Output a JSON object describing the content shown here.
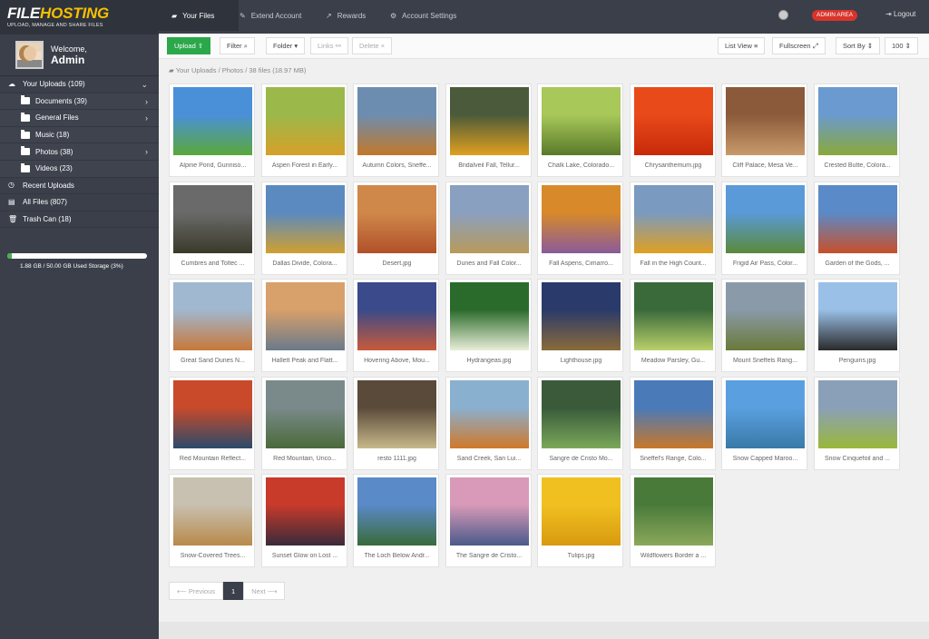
{
  "brand": {
    "logo_a": "FILE",
    "logo_b": "HOSTING",
    "tagline": "UPLOAD, MANAGE AND SHARE FILES"
  },
  "user": {
    "welcome": "Welcome,",
    "name": "Admin"
  },
  "sidebar": {
    "items": [
      {
        "label": "Your Uploads (109)",
        "icon": "cloud-icon",
        "level": 0,
        "chevron": "down"
      },
      {
        "label": "Documents (39)",
        "icon": "folder-icon",
        "level": 1,
        "chevron": "right"
      },
      {
        "label": "General Files",
        "icon": "folder-icon",
        "level": 1,
        "chevron": "right"
      },
      {
        "label": "Music (18)",
        "icon": "folder-icon",
        "level": 1,
        "chevron": ""
      },
      {
        "label": "Photos (38)",
        "icon": "folder-icon",
        "level": 1,
        "chevron": "right"
      },
      {
        "label": "Videos (23)",
        "icon": "folder-icon",
        "level": 1,
        "chevron": ""
      },
      {
        "label": "Recent Uploads",
        "icon": "clock-icon",
        "level": 0,
        "chevron": ""
      },
      {
        "label": "All Files (807)",
        "icon": "file-icon",
        "level": 0,
        "chevron": ""
      },
      {
        "label": "Trash Can (18)",
        "icon": "trash-icon",
        "level": 0,
        "chevron": ""
      }
    ],
    "storage_text": "1.88 GB / 50.00 GB Used Storage (3%)",
    "storage_fraction": 0.03
  },
  "topnav": {
    "tabs": [
      "Your Files",
      "Extend Account",
      "Rewards",
      "Account Settings"
    ],
    "admin": "ADMIN AREA",
    "logout": "Logout"
  },
  "toolbar": {
    "upload": "Upload",
    "filter": "Filter",
    "folder": "Folder",
    "links": "Links",
    "delete": "Delete",
    "list_view": "List View",
    "fullscreen": "Fullscreen",
    "sort": "Sort By",
    "per_page": "100"
  },
  "breadcrumb": {
    "root": "Your Uploads",
    "folder": "Photos",
    "count": "38 files (18.97 MB)"
  },
  "files": [
    {
      "name": "Alpine Pond, Gunniso...",
      "c1": "#4a90d9",
      "c2": "#5aa83a"
    },
    {
      "name": "Aspen Forest in Early...",
      "c1": "#9bb84a",
      "c2": "#d6a02a"
    },
    {
      "name": "Autumn Colors, Sneffe...",
      "c1": "#6d8db0",
      "c2": "#c2782a"
    },
    {
      "name": "Bridalveil Fall, Tellur...",
      "c1": "#4a5a3a",
      "c2": "#e0a020"
    },
    {
      "name": "Chalk Lake, Colorado...",
      "c1": "#a8c85a",
      "c2": "#5a7a2a"
    },
    {
      "name": "Chrysanthemum.jpg",
      "c1": "#e84a1a",
      "c2": "#c82a0a"
    },
    {
      "name": "Cliff Palace, Mesa Ve...",
      "c1": "#8a5a3a",
      "c2": "#c89a6a"
    },
    {
      "name": "Crested Butte, Colora...",
      "c1": "#6a9ad0",
      "c2": "#8aa83a"
    },
    {
      "name": "Cumbres and Toltec ...",
      "c1": "#6a6a6a",
      "c2": "#3a3a2a"
    },
    {
      "name": "Dallas Divide, Colora...",
      "c1": "#5a8ac0",
      "c2": "#d0a030"
    },
    {
      "name": "Desert.jpg",
      "c1": "#d0884a",
      "c2": "#b0502a"
    },
    {
      "name": "Dunes and Fall Color...",
      "c1": "#8aa0c0",
      "c2": "#b89a5a"
    },
    {
      "name": "Fall Aspens, Cimarro...",
      "c1": "#d88a2a",
      "c2": "#8a5a9a"
    },
    {
      "name": "Fall in the High Count...",
      "c1": "#7a9ac0",
      "c2": "#e0a020"
    },
    {
      "name": "Frigid Air Pass, Color...",
      "c1": "#5a9ad8",
      "c2": "#5a8a3a"
    },
    {
      "name": "Garden of the Gods, ...",
      "c1": "#5a8ac8",
      "c2": "#c8502a"
    },
    {
      "name": "Great Sand Dunes N...",
      "c1": "#a0b8d0",
      "c2": "#c8783a"
    },
    {
      "name": "Hallett Peak and Flatt...",
      "c1": "#d8a06a",
      "c2": "#6a7a8a"
    },
    {
      "name": "Hovering Above, Mou...",
      "c1": "#3a4a8a",
      "c2": "#c85a3a"
    },
    {
      "name": "Hydrangeas.jpg",
      "c1": "#2a6a2a",
      "c2": "#e8eed8"
    },
    {
      "name": "Lighthouse.jpg",
      "c1": "#2a3a6a",
      "c2": "#8a6a3a"
    },
    {
      "name": "Meadow Parsley, Gu...",
      "c1": "#3a6a3a",
      "c2": "#b8d06a"
    },
    {
      "name": "Mount Sneffels Rang...",
      "c1": "#8a9aa8",
      "c2": "#6a7a3a"
    },
    {
      "name": "Penguins.jpg",
      "c1": "#9ac0e8",
      "c2": "#2a2a2a"
    },
    {
      "name": "Red Mountain Reflect...",
      "c1": "#c84a2a",
      "c2": "#2a4a6a"
    },
    {
      "name": "Red Mountain, Unco...",
      "c1": "#7a8a8a",
      "c2": "#4a6a3a"
    },
    {
      "name": "resto 1111.jpg",
      "c1": "#5a4a3a",
      "c2": "#c8b88a"
    },
    {
      "name": "Sand Creek, San Lui...",
      "c1": "#8ab0d0",
      "c2": "#d0782a"
    },
    {
      "name": "Sangre de Cristo Mo...",
      "c1": "#3a5a3a",
      "c2": "#7aa85a"
    },
    {
      "name": "Sneffel's Range, Colo...",
      "c1": "#4a7ab8",
      "c2": "#c8782a"
    },
    {
      "name": "Snow Capped Maroo...",
      "c1": "#5aa0e0",
      "c2": "#3a7aa8"
    },
    {
      "name": "Snow Cinquefoil and ...",
      "c1": "#8aa0b8",
      "c2": "#9ab83a"
    },
    {
      "name": "Snow-Covered Trees...",
      "c1": "#c8c0b0",
      "c2": "#b88a4a"
    },
    {
      "name": "Sunset Glow on Lost ...",
      "c1": "#c83a2a",
      "c2": "#3a2a3a"
    },
    {
      "name": "The Loch Below Andr...",
      "c1": "#5a8ac8",
      "c2": "#3a6a3a"
    },
    {
      "name": "The Sangre de Cristo...",
      "c1": "#d89ab8",
      "c2": "#4a5a8a"
    },
    {
      "name": "Tulips.jpg",
      "c1": "#f0c020",
      "c2": "#d89a10"
    },
    {
      "name": "Wildflowers Border a ...",
      "c1": "#4a7a3a",
      "c2": "#8aa85a"
    }
  ],
  "pagination": {
    "prev": "Previous",
    "current": "1",
    "next": "Next"
  }
}
